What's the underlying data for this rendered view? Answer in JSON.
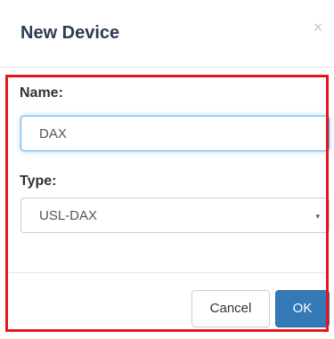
{
  "dialog": {
    "title": "New Device",
    "close_symbol": "×",
    "close_icon": "close-icon"
  },
  "form": {
    "name_label": "Name:",
    "name_value": "DAX",
    "type_label": "Type:",
    "type_selected": "USL-DAX",
    "caret_symbol": "▾"
  },
  "footer": {
    "cancel_label": "Cancel",
    "ok_label": "OK"
  },
  "colors": {
    "title": "#2e3a55",
    "highlight_border": "#e8141c",
    "focus_border": "#66afe9",
    "primary_button": "#337ab7"
  }
}
